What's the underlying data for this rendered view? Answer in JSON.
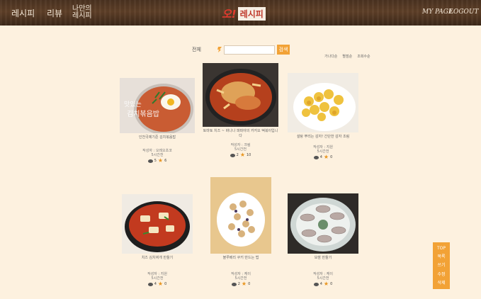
{
  "header": {
    "nav": [
      "레시피",
      "리뷰",
      "나만의\n레시피"
    ],
    "logo_mark": "오!",
    "logo_text": "레시피",
    "my_page": "MY PAGE",
    "logout": "LOGOUT"
  },
  "search": {
    "label": "전체",
    "placeholder": "",
    "button": "검색"
  },
  "sort": [
    "가나다순",
    "별점순",
    "조회수순"
  ],
  "cards": [
    {
      "title": "인천국제기준 김치볶음밥",
      "writer": "작성자 : 오레오초코",
      "date": "5시간전",
      "views": "5",
      "stars": "6"
    },
    {
      "title": "토마토 치즈 ~ 바나나 파파야의 카카오 떡볶이입니다",
      "writer": "작성자 : 크림",
      "date": "5시간전",
      "views": "2",
      "stars": "10"
    },
    {
      "title": "설탕 뿌리는 감자! 간단한 감자 조림",
      "writer": "작성자 : 지원",
      "date": "5시간전",
      "views": "4",
      "stars": "0"
    },
    {
      "title": "치즈 김치찌개 만들기",
      "writer": "작성자 : 지원",
      "date": "5시간전",
      "views": "4",
      "stars": "0"
    },
    {
      "title": "블루베리 쿠키 만드는 법",
      "writer": "작성자 : 케이",
      "date": "5시간전",
      "views": "2",
      "stars": "0"
    },
    {
      "title": "보쌈 만들기",
      "writer": "작성자 : 케이",
      "date": "5시간전",
      "views": "4",
      "stars": "0"
    }
  ],
  "side_panel": [
    "TOP",
    "목록",
    "쓰기",
    "수정",
    "삭제"
  ]
}
